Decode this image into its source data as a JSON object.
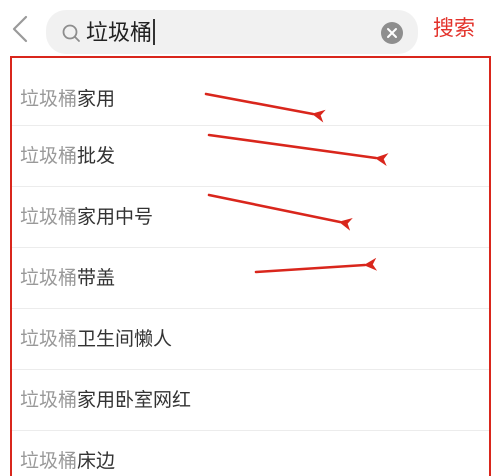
{
  "header": {
    "back_icon": "chevron-left-icon",
    "search_icon": "search-icon",
    "query": "垃圾桶",
    "clear_icon": "clear-circle-icon",
    "search_button_label": "搜索",
    "accent_color": "#e3322b"
  },
  "suggestions": {
    "keyword": "垃圾桶",
    "items": [
      {
        "suffix": "家用"
      },
      {
        "suffix": "批发"
      },
      {
        "suffix": "家用中号"
      },
      {
        "suffix": "带盖"
      },
      {
        "suffix": "卫生间懒人"
      },
      {
        "suffix": "家用卧室网红"
      },
      {
        "suffix": "床边"
      }
    ]
  },
  "annotation": {
    "box_color": "#d9261c",
    "arrow_color": "#d9261c"
  }
}
